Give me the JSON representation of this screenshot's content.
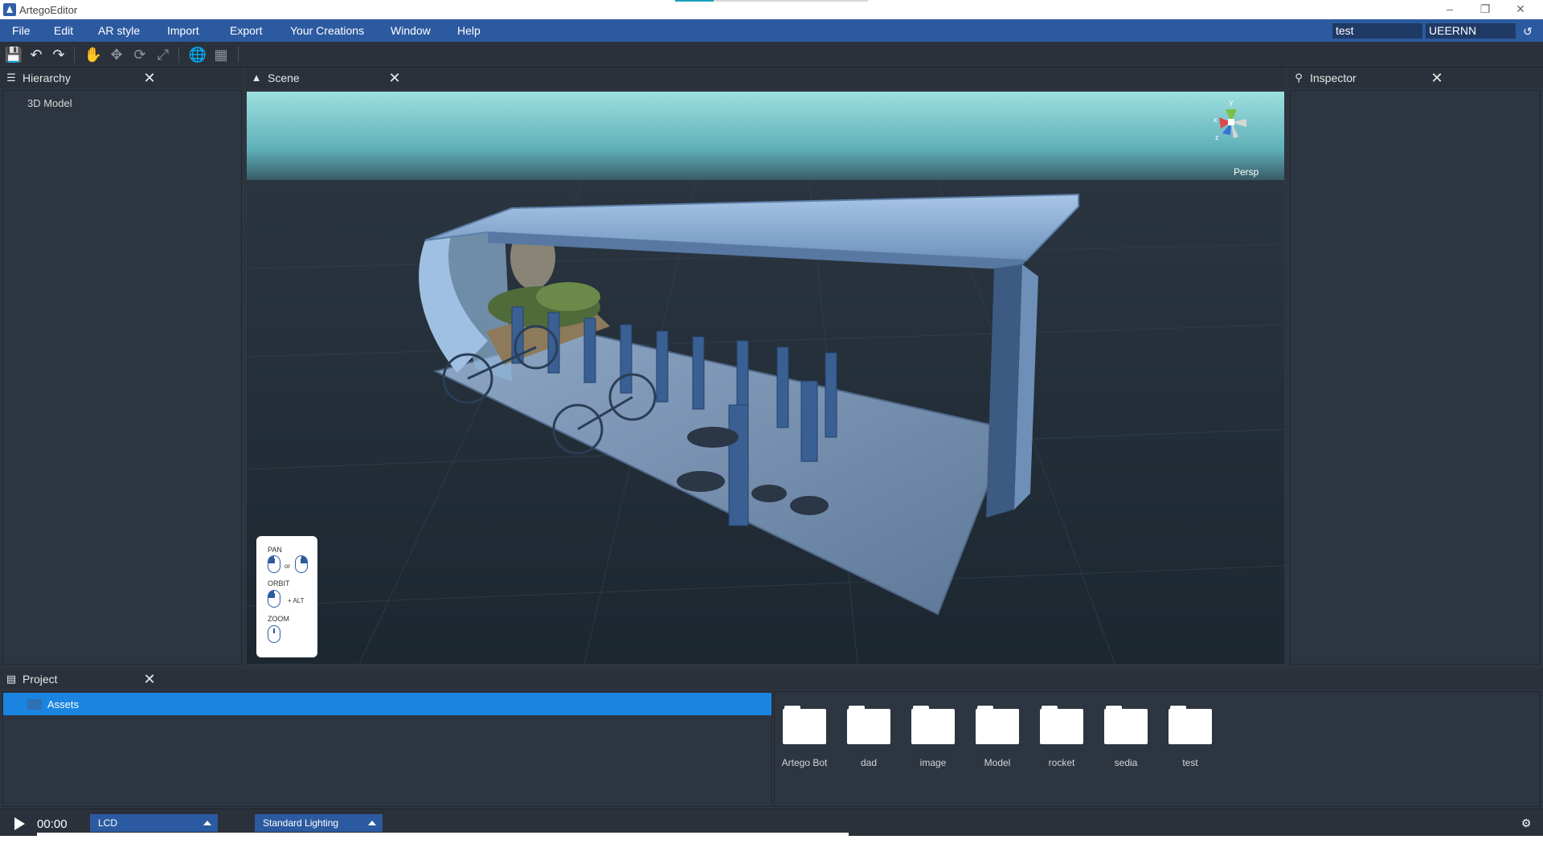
{
  "window": {
    "title": "ArtegoEditor",
    "progress_fraction": 0.2,
    "controls": [
      "minimize-icon",
      "restore-icon",
      "close-icon"
    ]
  },
  "menu": {
    "items": [
      "File",
      "Edit",
      "AR style",
      "Import",
      "Export",
      "Your Creations",
      "Window",
      "Help"
    ],
    "project_field": "test",
    "user_field": "UEERNN",
    "share_icon": "share-icon"
  },
  "toolbar": {
    "icons": [
      "save-icon",
      "undo-icon",
      "redo-icon",
      "hand-icon",
      "move-icon",
      "rotate-icon",
      "scale-icon",
      "globe-icon",
      "grid-icon"
    ]
  },
  "hierarchy": {
    "title": "Hierarchy",
    "items": [
      "3D Model"
    ]
  },
  "scene": {
    "title": "Scene",
    "view_mode": "Persp",
    "gizmo": {
      "x": "x",
      "y": "y",
      "z": "z"
    },
    "controls_help": {
      "pan": "PAN",
      "or": "or",
      "orbit": "ORBIT",
      "alt": "+ ALT",
      "zoom": "ZOOM"
    }
  },
  "inspector": {
    "title": "Inspector"
  },
  "project": {
    "title": "Project",
    "tree": [
      "Assets"
    ],
    "folders": [
      "Artego Bot",
      "dad",
      "image",
      "Model",
      "rocket",
      "sedia",
      "test"
    ]
  },
  "bottom": {
    "time": "00:00",
    "display_mode": "LCD",
    "lighting": "Standard Lighting",
    "robot_icon": "robot-icon"
  },
  "colors": {
    "menu_bar": "#2c5aa0",
    "panel_bg": "#2d3540",
    "selection": "#1a84e0",
    "accent_progress": "#1aa0b8"
  }
}
